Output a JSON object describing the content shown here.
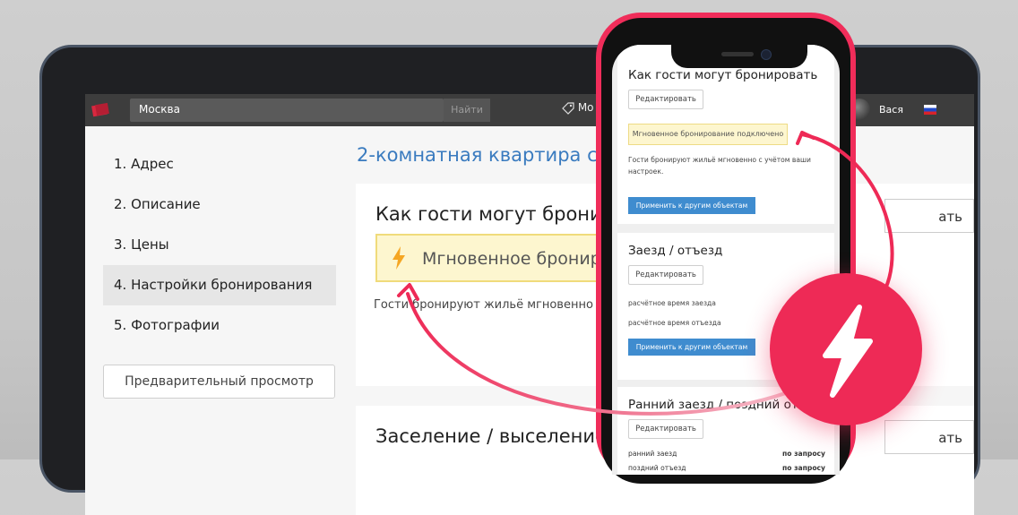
{
  "header": {
    "search_value": "Москва",
    "search_button": "Найти",
    "nav_item": "Мо",
    "user_name": "Вася"
  },
  "sidebar": {
    "items": [
      {
        "label": "1. Адрес"
      },
      {
        "label": "2. Описание"
      },
      {
        "label": "3. Цены"
      },
      {
        "label": "4. Настройки бронирования",
        "active": true
      },
      {
        "label": "5. Фотографии"
      }
    ],
    "preview_button": "Предварительный просмотр"
  },
  "main": {
    "listing_title": "2-комнатная квартира с в",
    "booking_card": {
      "title": "Как гости могут бронир",
      "instant_label": "Мгновенное бронир",
      "description": "Гости бронируют жильё мгновенно с",
      "edit_button": "ать"
    },
    "checkin_card": {
      "title": "Заселение / выселение",
      "edit_button": "ать"
    }
  },
  "phone": {
    "booking": {
      "title": "Как гости могут бронировать",
      "edit_button": "Редактировать",
      "instant_note": "Мгновенное бронирование подключено",
      "description_line1": "Гости бронируют жильё мгновенно с учётом ваши",
      "description_line2": "настроек.",
      "apply_button": "Применить к другим объектам"
    },
    "checkin": {
      "title": "Заезд / отъезд",
      "edit_button": "Редактировать",
      "checkin_time": "расчётное время заезда",
      "checkout_time": "расчётное время отъезда",
      "apply_button": "Применить к другим объектам"
    },
    "early_late": {
      "title": "Ранний заезд / поздний отъ",
      "edit_button": "Редактировать",
      "early_label": "ранний заезд",
      "early_value": "по запросу",
      "late_label": "поздний отъезд",
      "late_value": "по запросу"
    }
  },
  "colors": {
    "accent": "#ee2a56",
    "link_blue": "#3a7bbf",
    "apply_blue": "#3f8ccf",
    "note_yellow": "#fdf6cf",
    "bolt_orange": "#f5a623"
  },
  "icons": [
    "logo-icon",
    "tag-icon",
    "lightning-icon",
    "flag-icon",
    "arrow-icon"
  ]
}
